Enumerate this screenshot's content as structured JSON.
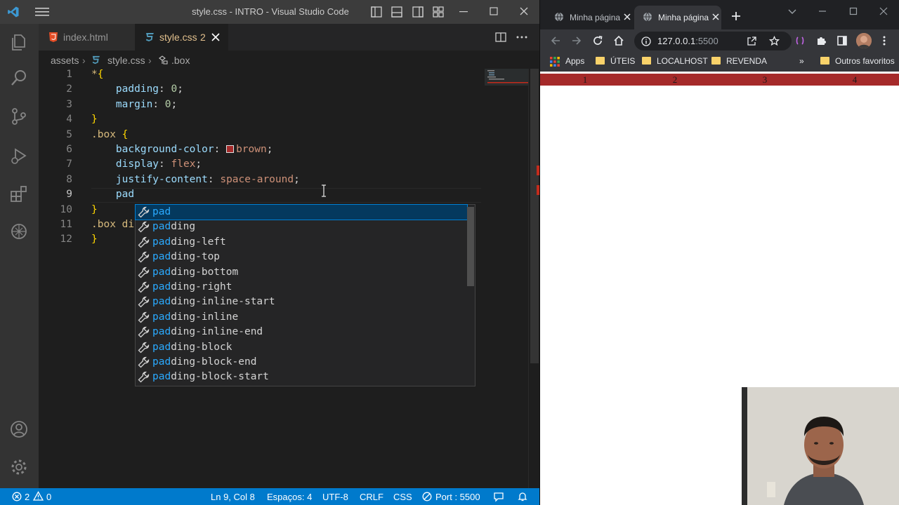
{
  "vscode": {
    "window_title": "style.css - INTRO - Visual Studio Code",
    "tabs": [
      {
        "label": "index.html",
        "icon": "html5-icon"
      },
      {
        "label": "style.css",
        "problems": "2",
        "icon": "css3-icon"
      }
    ],
    "breadcrumb": {
      "folder": "assets",
      "file": "style.css",
      "symbol": ".box"
    },
    "line_numbers": [
      "1",
      "2",
      "3",
      "4",
      "5",
      "6",
      "7",
      "8",
      "9",
      "10",
      "11",
      "12"
    ],
    "code": {
      "l1_sel": "*",
      "l1_brace": "{",
      "l2_prop": "padding",
      "l2_val": "0",
      "l3_prop": "margin",
      "l3_val": "0",
      "l4_brace": "}",
      "l5_sel": ".box",
      "l5_brace": "{",
      "l6_prop": "background-color",
      "l6_val": "brown",
      "l7_prop": "display",
      "l7_val": "flex",
      "l8_prop": "justify-content",
      "l8_val": "space-around",
      "l9_text": "pad",
      "l10_brace": "}",
      "l11_text": ".box di",
      "l12_brace": "}"
    },
    "suggestions": [
      {
        "match": "pad",
        "rest": ""
      },
      {
        "match": "pad",
        "rest": "ding"
      },
      {
        "match": "pad",
        "rest": "ding-left"
      },
      {
        "match": "pad",
        "rest": "ding-top"
      },
      {
        "match": "pad",
        "rest": "ding-bottom"
      },
      {
        "match": "pad",
        "rest": "ding-right"
      },
      {
        "match": "pad",
        "rest": "ding-inline-start"
      },
      {
        "match": "pad",
        "rest": "ding-inline"
      },
      {
        "match": "pad",
        "rest": "ding-inline-end"
      },
      {
        "match": "pad",
        "rest": "ding-block"
      },
      {
        "match": "pad",
        "rest": "ding-block-end"
      },
      {
        "match": "pad",
        "rest": "ding-block-start"
      }
    ],
    "status": {
      "errors": "2",
      "warnings": "0",
      "position": "Ln 9, Col 8",
      "spaces": "Espaços: 4",
      "encoding": "UTF-8",
      "eol": "CRLF",
      "language": "CSS",
      "port": "Port : 5500"
    },
    "colors": {
      "accent": "#007acc",
      "brown": "#a52a2a"
    }
  },
  "browser": {
    "tabs": [
      {
        "title": "Minha página"
      },
      {
        "title": "Minha página"
      }
    ],
    "url_host": "127.0.0.1",
    "url_port": ":5500",
    "bookmarks": [
      "Apps",
      "ÚTEIS",
      "LOCALHOST",
      "REVENDA",
      "»",
      "Outros favoritos"
    ],
    "page_items": [
      "1",
      "2",
      "3",
      "4"
    ]
  }
}
